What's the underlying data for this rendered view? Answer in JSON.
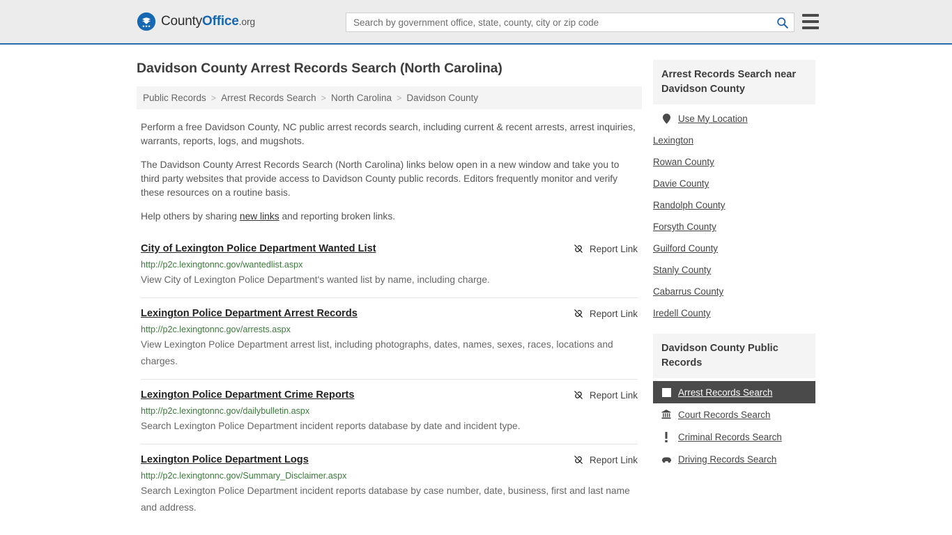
{
  "header": {
    "logo": {
      "part1": "County",
      "part2": "Office",
      "part3": ".org"
    },
    "search": {
      "placeholder": "Search by government office, state, county, city or zip code",
      "value": ""
    },
    "search_icon": "search-icon",
    "menu_icon": "hamburger-menu-icon"
  },
  "main": {
    "title": "Davidson County Arrest Records Search (North Carolina)",
    "breadcrumb": [
      "Public Records",
      "Arrest Records Search",
      "North Carolina",
      "Davidson County"
    ],
    "breadcrumb_separator": ">",
    "intro": {
      "p1": "Perform a free Davidson County, NC public arrest records search, including current & recent arrests, arrest inquiries, warrants, reports, logs, and mugshots.",
      "p2": "The Davidson County Arrest Records Search (North Carolina) links below open in a new window and take you to third party websites that provide access to Davidson County public records. Editors frequently monitor and verify these resources on a routine basis.",
      "p3_before": "Help others by sharing ",
      "p3_link": "new links",
      "p3_after": " and reporting broken links."
    },
    "report_link_label": "Report Link",
    "results": [
      {
        "title": "City of Lexington Police Department Wanted List",
        "url": "http://p2c.lexingtonnc.gov/wantedlist.aspx",
        "description": "View City of Lexington Police Department's wanted list by name, including charge."
      },
      {
        "title": "Lexington Police Department Arrest Records",
        "url": "http://p2c.lexingtonnc.gov/arrests.aspx",
        "description": "View Lexington Police Department arrest list, including photographs, dates, names, sexes, races, locations and charges."
      },
      {
        "title": "Lexington Police Department Crime Reports",
        "url": "http://p2c.lexingtonnc.gov/dailybulletin.aspx",
        "description": "Search Lexington Police Department incident reports database by date and incident type."
      },
      {
        "title": "Lexington Police Department Logs",
        "url": "http://p2c.lexingtonnc.gov/Summary_Disclaimer.aspx",
        "description": "Search Lexington Police Department incident reports database by case number, date, business, first and last name and address."
      }
    ]
  },
  "sidebar": {
    "nearby": {
      "heading": "Arrest Records Search near Davidson County",
      "items": [
        {
          "label": "Use My Location",
          "icon": "map-pin-icon"
        },
        {
          "label": "Lexington",
          "icon": ""
        },
        {
          "label": "Rowan County",
          "icon": ""
        },
        {
          "label": "Davie County",
          "icon": ""
        },
        {
          "label": "Randolph County",
          "icon": ""
        },
        {
          "label": "Forsyth County",
          "icon": ""
        },
        {
          "label": "Guilford County",
          "icon": ""
        },
        {
          "label": "Stanly County",
          "icon": ""
        },
        {
          "label": "Cabarrus County",
          "icon": ""
        },
        {
          "label": "Iredell County",
          "icon": ""
        }
      ]
    },
    "public_records": {
      "heading": "Davidson County Public Records",
      "items": [
        {
          "label": "Arrest Records Search",
          "icon": "fingerprint-icon",
          "active": true
        },
        {
          "label": "Court Records Search",
          "icon": "courthouse-icon",
          "active": false
        },
        {
          "label": "Criminal Records Search",
          "icon": "exclamation-icon",
          "active": false
        },
        {
          "label": "Driving Records Search",
          "icon": "car-icon",
          "active": false
        }
      ]
    }
  },
  "colors": {
    "brand_blue": "#1668b3",
    "header_bg": "#ececec",
    "header_border": "#2b6cb0",
    "url_green": "#3a7a3a",
    "active_bg": "#4a4a4a",
    "panel_bg": "#f4f4f4"
  }
}
